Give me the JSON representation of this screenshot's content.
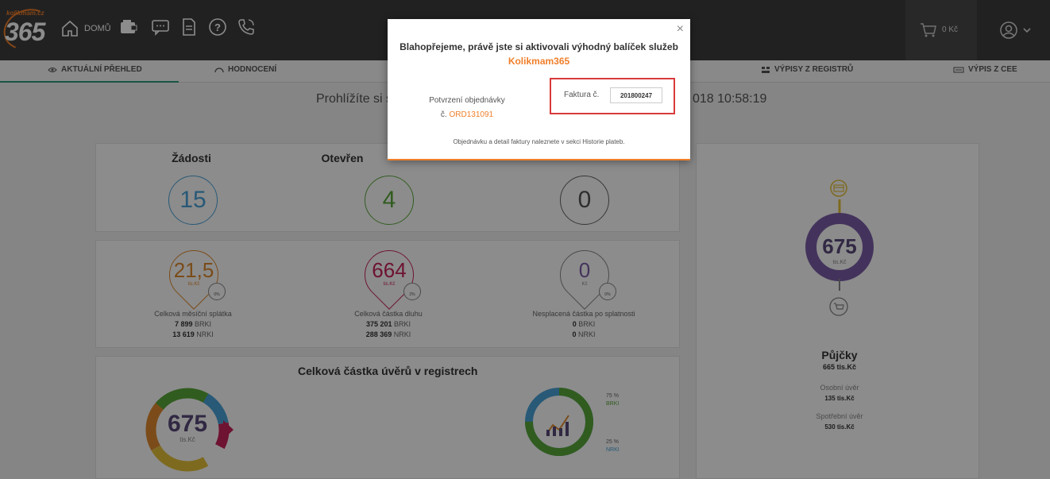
{
  "topbar": {
    "brand_small": "kolikmam.cz",
    "brand_big": "365",
    "home_label": "DOMŮ",
    "icons": [
      "home-icon",
      "wallet-icon",
      "chat-icon",
      "document-icon",
      "help-icon",
      "phone-icon"
    ],
    "cart_label": "0 Kč"
  },
  "tabs": [
    {
      "label": "AKTUÁLNÍ PŘEHLED",
      "icon": "eye-icon"
    },
    {
      "label": "HODNOCENÍ",
      "icon": "gauge-icon"
    },
    {
      "label": "VÝPISY Z REGISTRŮ",
      "icon": "registry-icon"
    },
    {
      "label": "VÝPIS Z CEE",
      "icon": "cee-icon"
    }
  ],
  "subtitle_left": "Prohlížíte si s",
  "subtitle_right": "018 10:58:19",
  "stats": {
    "zadosti": {
      "title": "Žádosti",
      "value": "15",
      "color": "#4aa3d9"
    },
    "otevrene": {
      "title": "Otevřen",
      "value": "4",
      "color": "#5aa83a"
    },
    "third": {
      "value": "0",
      "color": "#555555"
    }
  },
  "amounts": [
    {
      "value": "21,5",
      "unit": "tis.Kč",
      "pct": "0%",
      "caption": "Celková měsíční splátka",
      "line1_num": "7 899",
      "line1_unit": "BRKI",
      "line2_num": "13 619",
      "line2_unit": "NRKI",
      "color": "#e08a2e"
    },
    {
      "value": "664",
      "unit": "tis.Kč",
      "pct": "2%",
      "caption": "Celková částka dluhu",
      "line1_num": "375 201",
      "line1_unit": "BRKI",
      "line2_num": "288 369",
      "line2_unit": "NRKI",
      "color": "#c8245a"
    },
    {
      "value": "0",
      "unit": "Kč",
      "pct": "0%",
      "caption": "Nesplacená částka po splatnosti",
      "line1_num": "0",
      "line1_unit": "BRKI",
      "line2_num": "0",
      "line2_unit": "NRKI",
      "color": "#666666"
    }
  ],
  "loans_section": {
    "title": "Celková částka úvěrů v registrech",
    "donut_value": "675",
    "donut_unit": "tis.Kč",
    "brki_pct": "75 %",
    "brki_label": "BRKI",
    "nrki_pct": "25 %",
    "nrki_label": "NRKI"
  },
  "right_panel": {
    "donut_value": "675",
    "donut_unit": "tis.Kč",
    "title": "Půjčky",
    "total": "665 tis.Kč",
    "item1_label": "Osobní úvěr",
    "item1_value": "135 tis.Kč",
    "item2_label": "Spotřební úvěr",
    "item2_value": "530 tis.Kč"
  },
  "modal": {
    "title": "Blahopřejeme, právě jste si aktivovali výhodný balíček služeb",
    "brand": "Kolikmam365",
    "order_label": "Potvrzení objednávky",
    "order_prefix": "č.",
    "order_number": "ORD131091",
    "invoice_label": "Faktura č.",
    "invoice_number": "201800247",
    "note": "Objednávku a detail faktury naleznete v sekci Historie plateb.",
    "close": "×"
  },
  "colors": {
    "accent": "#f07f2a",
    "teal": "#2e9b7e",
    "purple": "#7a5ea8",
    "highlight": "#d93a3a"
  }
}
